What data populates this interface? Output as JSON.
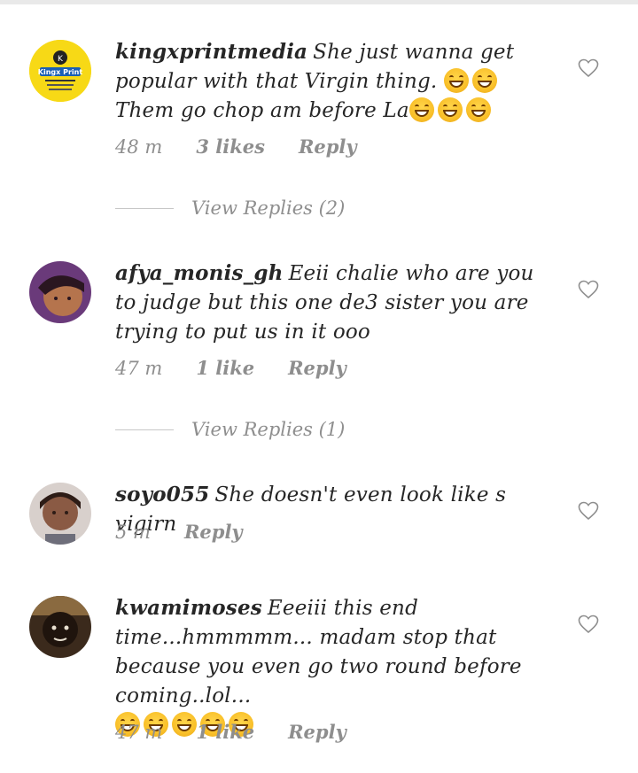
{
  "comments": [
    {
      "username": "kingxprintmedia",
      "text_parts": [
        "She just wanna get popular with that Virgin thing. ",
        " Them go chop am before La"
      ],
      "emoji_name": "grinning-squinting-face",
      "avatar_text": "Kingx Print",
      "time": "48 m",
      "likes": "3 likes",
      "reply": "Reply",
      "view_replies": "View Replies (2)"
    },
    {
      "username": "afya_monis_gh",
      "text": "Eeii chalie who are you to judge but this one de3 sister you are trying to put us in it ooo",
      "time": "47 m",
      "likes": "1 like",
      "reply": "Reply",
      "view_replies": "View Replies (1)"
    },
    {
      "username": "soyo055",
      "text": "She doesn't even look like s vigirn",
      "time": "5 m",
      "reply": "Reply"
    },
    {
      "username": "kwamimoses",
      "text": "Eeeiii this end time...hmmmmm... madam stop that because you even go two round before coming..lol...",
      "emoji_name": "grinning-face",
      "time": "47 m",
      "likes": "1 like",
      "reply": "Reply"
    }
  ],
  "colors": {
    "accent_avatar": "#f7d916",
    "muted": "#8e8e8e",
    "text": "#262626"
  }
}
